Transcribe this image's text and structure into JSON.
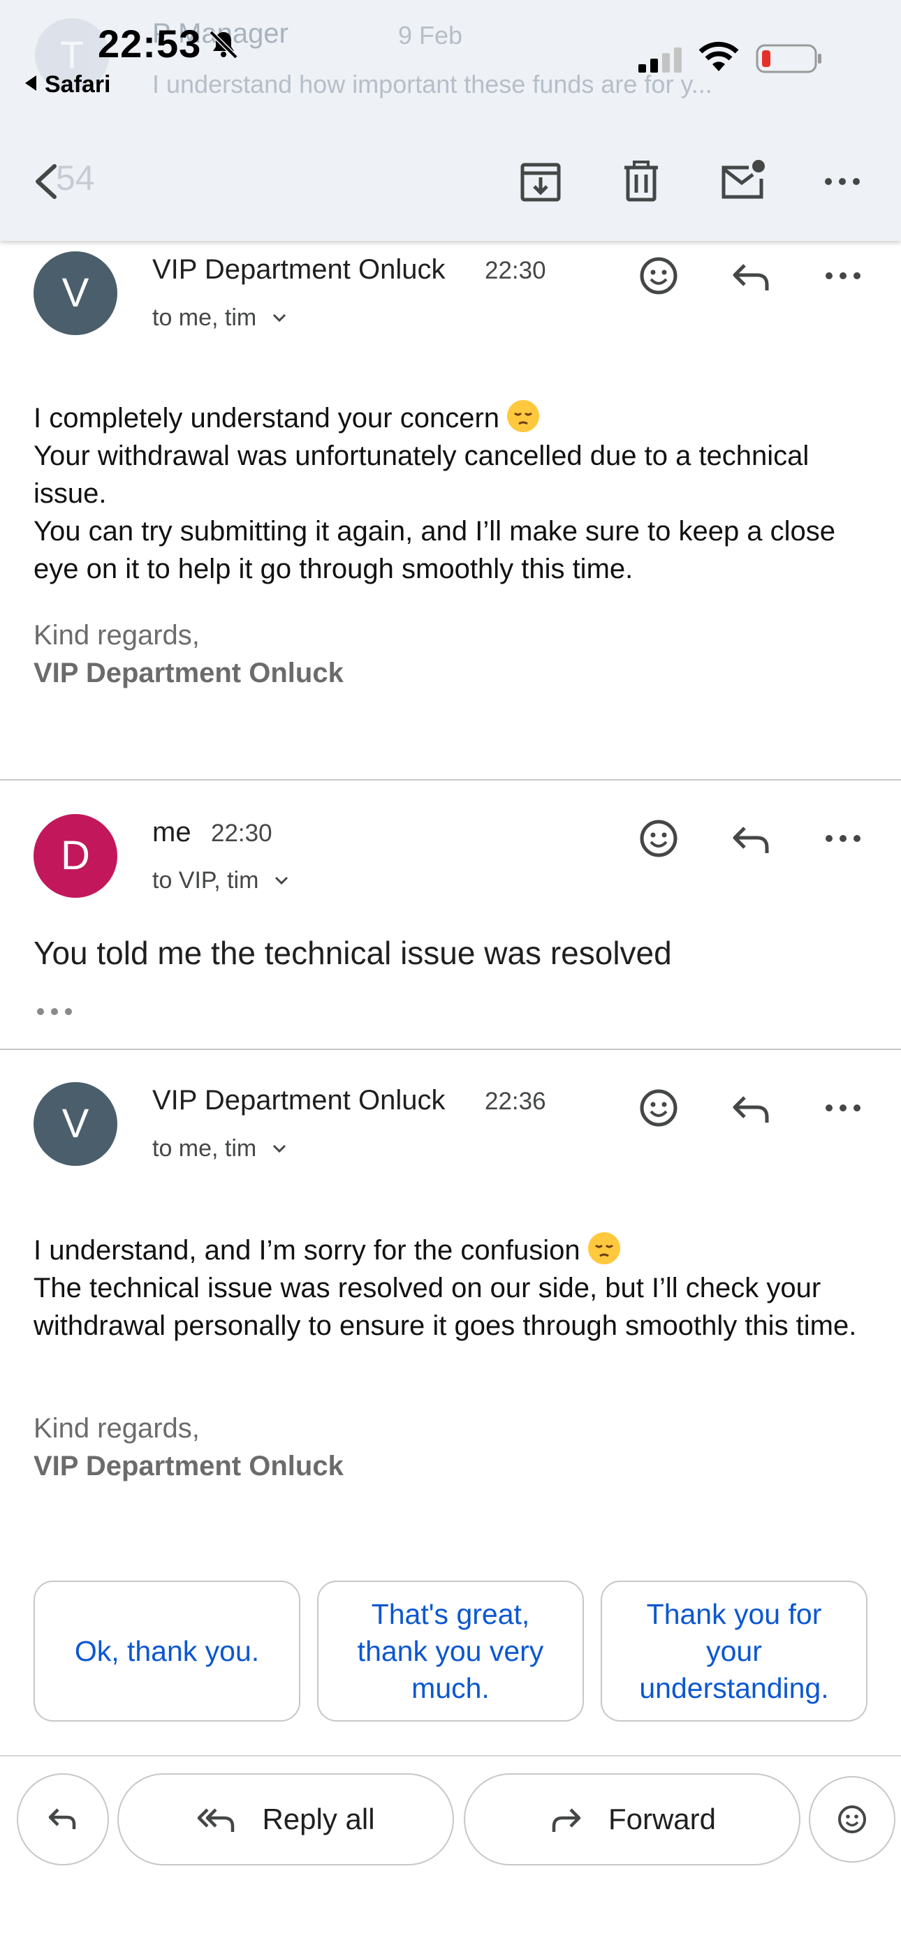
{
  "status_bar": {
    "time": "22:53",
    "back_app": "Safari"
  },
  "background_row": {
    "avatar_letter": "T",
    "sender_partial": "P Manager",
    "date": "9 Feb",
    "snippet": "I understand how important these funds are for y..."
  },
  "toolbar": {
    "count_partial": "54",
    "icons": [
      "back-icon",
      "archive-icon",
      "delete-icon",
      "mark-unread-icon",
      "more-icon"
    ]
  },
  "messages": [
    {
      "avatar_letter": "V",
      "avatar_color": "#4a5e6b",
      "sender": "VIP Department Onluck",
      "time": "22:30",
      "to": "to me, tim",
      "body": [
        "I completely understand your concern",
        "Your withdrawal was unfortunately cancelled due to a technical issue.",
        "You can try submitting it again, and I’ll make sure to keep a close eye on it to help it go through smoothly this time."
      ],
      "sign_off": "Kind regards,",
      "signature": "VIP Department Onluck"
    },
    {
      "avatar_letter": "D",
      "avatar_color": "#c2185b",
      "sender": "me",
      "time": "22:30",
      "to": "to VIP, tim",
      "body_preview": "You told me the technical issue was resolved"
    },
    {
      "avatar_letter": "V",
      "avatar_color": "#4a5e6b",
      "sender": "VIP Department Onluck",
      "time": "22:36",
      "to": "to me, tim",
      "body": [
        "I understand, and I’m sorry for the confusion",
        "The technical issue was resolved on our side, but I’ll check your withdrawal personally to ensure it goes through smoothly this time."
      ],
      "sign_off": "Kind regards,",
      "signature": "VIP Department Onluck"
    }
  ],
  "smart_replies": [
    "Ok, thank you.",
    "That's great, thank you very much.",
    "Thank you for your understanding."
  ],
  "actions": {
    "reply_all": "Reply all",
    "forward": "Forward"
  },
  "colors": {
    "accent": "#0b57d0",
    "battery_low": "#e5302a"
  }
}
